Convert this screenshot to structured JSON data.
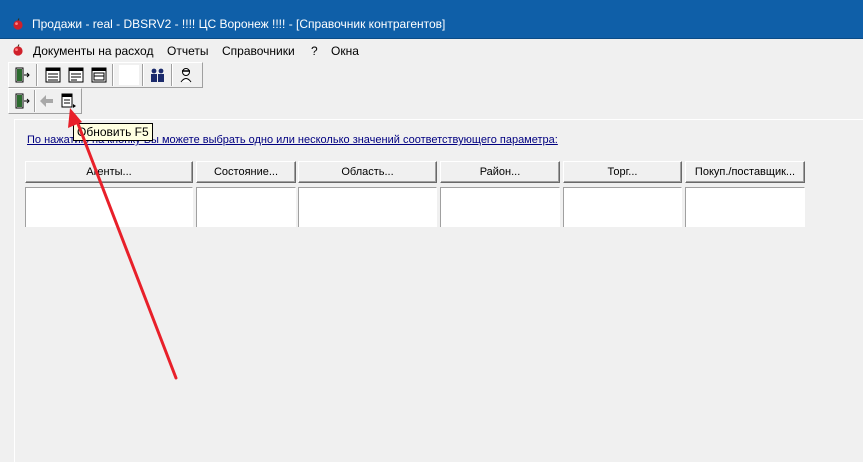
{
  "window": {
    "title": "Продажи - real - DBSRV2 -     !!!!  ЦС Воронеж  !!!! - [Справочник контрагентов]",
    "app_icon": "apple-icon"
  },
  "menu": {
    "items": [
      {
        "label": "Документы на расход"
      },
      {
        "label": "Отчеты"
      },
      {
        "label": "Справочники"
      },
      {
        "label": "?"
      },
      {
        "label": "Окна"
      }
    ]
  },
  "toolbar_top": {
    "buttons": [
      "exit-door-icon",
      "list-doc-icon",
      "list-doc-icon-2",
      "list-doc-icon-3",
      "blank-button",
      "users-icon",
      "agent-icon"
    ]
  },
  "toolbar_nav": {
    "buttons": [
      "exit-door-icon",
      "back-arrow-icon",
      "refresh-icon"
    ],
    "refresh_tooltip": "Обновить F5"
  },
  "panel": {
    "hint": "По нажатию на кнопку Вы можете выбрать одно или несколько значений соответствующего параметра:",
    "parameters": [
      {
        "label": "Агенты..."
      },
      {
        "label": "Состояние..."
      },
      {
        "label": "Область..."
      },
      {
        "label": "Район..."
      },
      {
        "label": "Торг..."
      },
      {
        "label": "Покуп./поставщик..."
      }
    ]
  },
  "colors": {
    "titlebar": "#0f5fa8",
    "annotation_arrow": "#e8202a",
    "tooltip_bg": "#ffffe1",
    "hint_link": "#000080"
  }
}
